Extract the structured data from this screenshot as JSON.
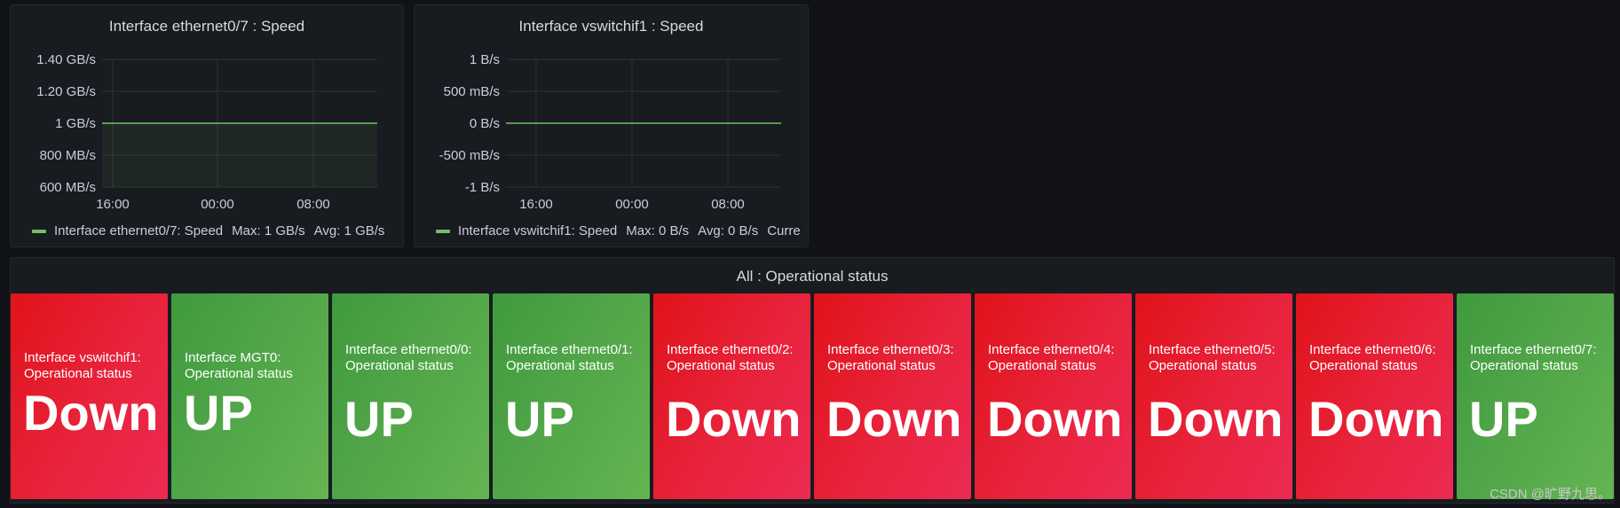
{
  "colors": {
    "series": "#73bf69",
    "grid": "#2f3238",
    "down": "#e0131a",
    "up": "#54a84a"
  },
  "speed_panels": [
    {
      "title": "Interface ethernet0/7 : Speed",
      "legend": {
        "series": "Interface ethernet0/7: Speed",
        "max": "Max: 1 GB/s",
        "avg": "Avg: 1 GB/s"
      },
      "chart_data": {
        "type": "line",
        "x_ticks": [
          "16:00",
          "00:00",
          "08:00"
        ],
        "y_ticks": [
          "1.40 GB/s",
          "1.20 GB/s",
          "1 GB/s",
          "800 MB/s",
          "600 MB/s"
        ],
        "ylim": [
          600,
          1400
        ],
        "y_unit": "MB/s",
        "series": [
          {
            "name": "Interface ethernet0/7: Speed",
            "values": [
              1000,
              1000
            ],
            "fill": true
          }
        ]
      }
    },
    {
      "title": "Interface vswitchif1 : Speed",
      "legend": {
        "series": "Interface vswitchif1: Speed",
        "max": "Max: 0 B/s",
        "avg": "Avg: 0 B/s",
        "current": "Curre"
      },
      "chart_data": {
        "type": "line",
        "x_ticks": [
          "16:00",
          "00:00",
          "08:00"
        ],
        "y_ticks": [
          "1 B/s",
          "500 mB/s",
          "0 B/s",
          "-500 mB/s",
          "-1 B/s"
        ],
        "ylim": [
          -1,
          1
        ],
        "y_unit": "B/s",
        "series": [
          {
            "name": "Interface vswitchif1: Speed",
            "values": [
              0,
              0
            ],
            "fill": false
          }
        ]
      }
    }
  ],
  "status_panel": {
    "title": "All : Operational status",
    "tiles": [
      {
        "label": "Interface vswitchif1: Operational status",
        "value": "Down",
        "state": "down"
      },
      {
        "label": "Interface MGT0: Operational status",
        "value": "UP",
        "state": "up"
      },
      {
        "label": "Interface ethernet0/0: Operational status",
        "value": "UP",
        "state": "up"
      },
      {
        "label": "Interface ethernet0/1: Operational status",
        "value": "UP",
        "state": "up"
      },
      {
        "label": "Interface ethernet0/2: Operational status",
        "value": "Down",
        "state": "down"
      },
      {
        "label": "Interface ethernet0/3: Operational status",
        "value": "Down",
        "state": "down"
      },
      {
        "label": "Interface ethernet0/4: Operational status",
        "value": "Down",
        "state": "down"
      },
      {
        "label": "Interface ethernet0/5: Operational status",
        "value": "Down",
        "state": "down"
      },
      {
        "label": "Interface ethernet0/6: Operational status",
        "value": "Down",
        "state": "down"
      },
      {
        "label": "Interface ethernet0/7: Operational status",
        "value": "UP",
        "state": "up"
      }
    ]
  },
  "watermark": "CSDN @旷野九思。"
}
